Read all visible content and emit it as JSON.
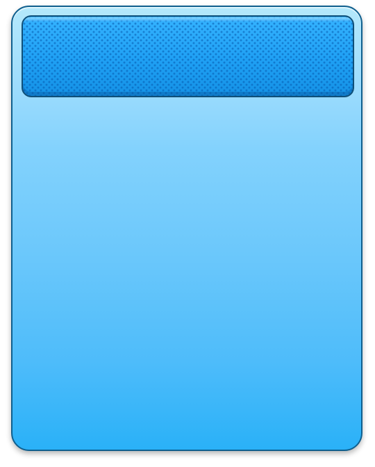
{
  "panel": {
    "title": "",
    "colors": {
      "border": "#0f5f8e",
      "gradient_top": "#b4e8fb",
      "gradient_bottom": "#2ab1f8",
      "header_fill": "#1e9ff2",
      "header_dots": "#055aaf"
    }
  }
}
